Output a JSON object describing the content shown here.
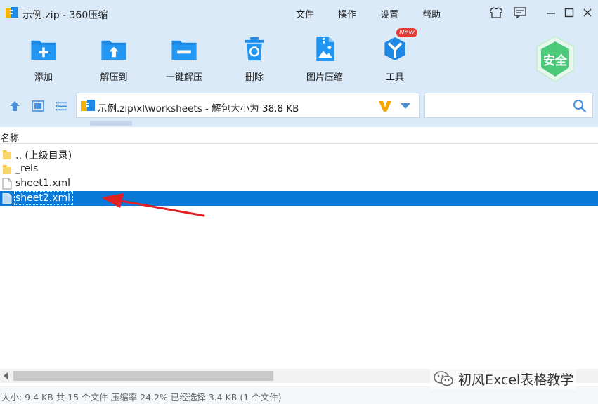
{
  "window": {
    "title": "示例.zip - 360压缩",
    "menu": [
      "文件",
      "操作",
      "设置",
      "帮助"
    ]
  },
  "toolbar": {
    "tools": [
      {
        "label": "添加",
        "icon": "add-icon"
      },
      {
        "label": "解压到",
        "icon": "extract-to-icon"
      },
      {
        "label": "一键解压",
        "icon": "one-click-extract-icon"
      },
      {
        "label": "删除",
        "icon": "delete-icon"
      },
      {
        "label": "图片压缩",
        "icon": "image-compress-icon"
      },
      {
        "label": "工具",
        "icon": "tools-icon"
      }
    ],
    "new_badge": "New",
    "safe_label": "安全"
  },
  "address": {
    "path": "示例.zip\\xl\\worksheets - 解包大小为 38.8 KB"
  },
  "search": {
    "placeholder": ""
  },
  "list": {
    "column_name": "名称",
    "rows": [
      {
        "name": ".. (上级目录)",
        "type": "folder",
        "selected": false
      },
      {
        "name": "_rels",
        "type": "folder",
        "selected": false
      },
      {
        "name": "sheet1.xml",
        "type": "file",
        "selected": false
      },
      {
        "name": "sheet2.xml",
        "type": "file",
        "selected": true
      }
    ]
  },
  "status": {
    "text": "大小: 9.4 KB 共 15 个文件 压缩率 24.2% 已经选择 3.4 KB (1 个文件)"
  },
  "watermark": {
    "text": "初风Excel表格教学"
  },
  "colors": {
    "chrome_bg": "#dbeaf9",
    "accent": "#1e88e5",
    "selection": "#0a78d7",
    "safe_green": "#4cc97a",
    "arrow_red": "#e02020"
  }
}
